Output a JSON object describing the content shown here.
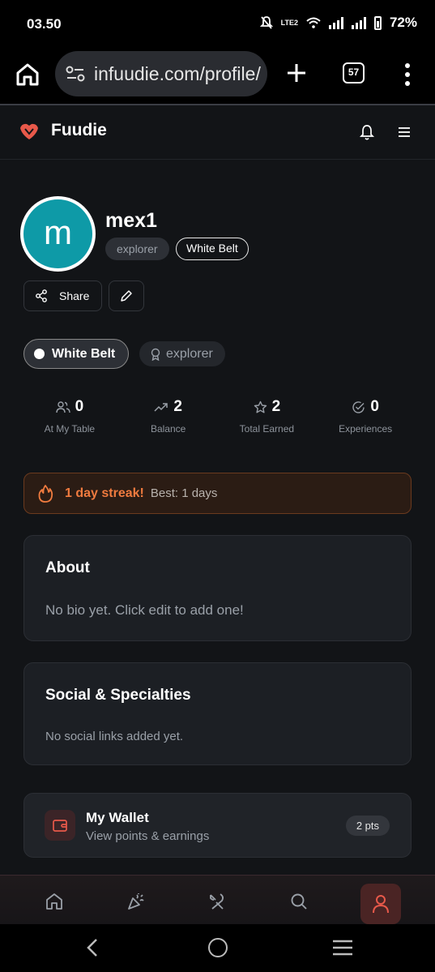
{
  "status_bar": {
    "time": "03.50",
    "battery": "72%",
    "network_label": "LTE2"
  },
  "browser": {
    "url": "infuudie.com/profile/",
    "tab_count": "57"
  },
  "app": {
    "brand": "Fuudie",
    "brand_color": "#e8594a"
  },
  "profile": {
    "avatar_letter": "m",
    "avatar_color": "#0e9aa7",
    "username": "mex1",
    "tags": [
      "explorer",
      "White Belt"
    ],
    "share_label": "Share"
  },
  "badges": {
    "belt": "White Belt",
    "role": "explorer"
  },
  "stats": [
    {
      "icon": "users-icon",
      "value": "0",
      "label": "At My Table"
    },
    {
      "icon": "trending-up-icon",
      "value": "2",
      "label": "Balance"
    },
    {
      "icon": "star-icon",
      "value": "2",
      "label": "Total Earned"
    },
    {
      "icon": "check-circle-icon",
      "value": "0",
      "label": "Experiences"
    }
  ],
  "streak": {
    "text": "1 day streak!",
    "best": "Best: 1 days",
    "accent": "#f07b3f"
  },
  "about": {
    "title": "About",
    "body": "No bio yet. Click edit to add one!"
  },
  "social": {
    "title": "Social & Specialties",
    "body": "No social links added yet."
  },
  "wallet": {
    "title": "My Wallet",
    "subtitle": "View points & earnings",
    "badge": "2 pts"
  },
  "bottom_nav": {
    "items": [
      "home-icon",
      "party-icon",
      "utensils-icon",
      "search-icon",
      "user-icon"
    ],
    "active": "user-icon"
  }
}
